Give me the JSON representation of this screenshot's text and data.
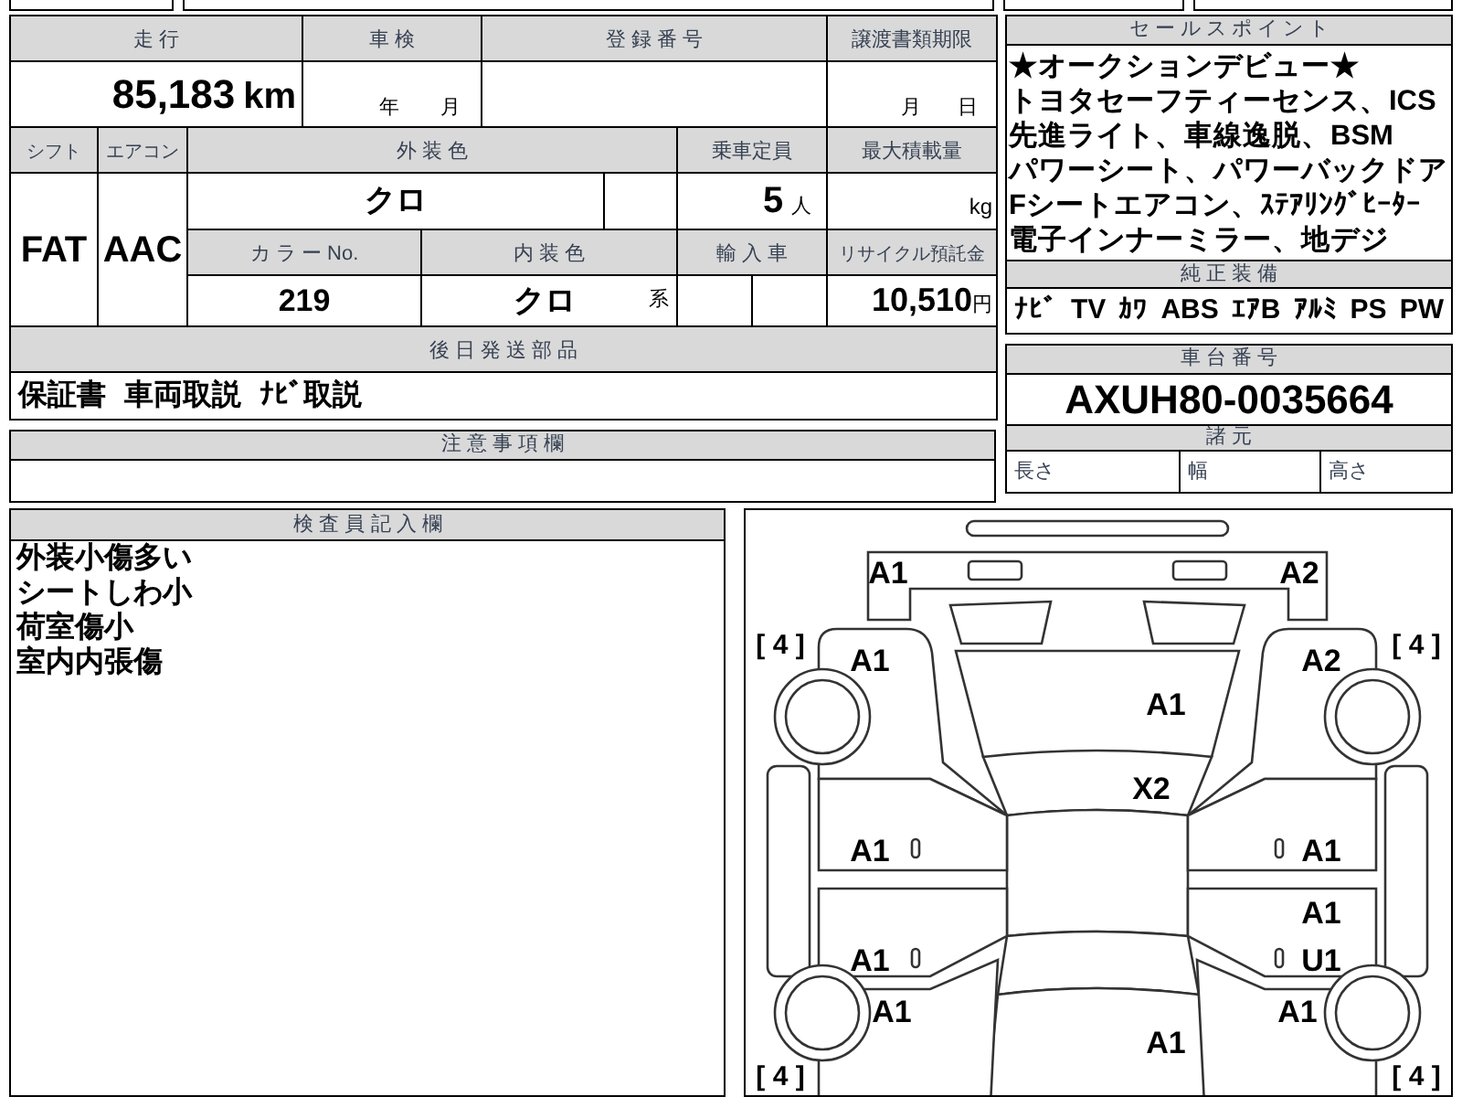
{
  "vehicle_info": {
    "mileage": {
      "label": "走 行",
      "value": "85,183",
      "unit": "km"
    },
    "inspection": {
      "label": "車 検",
      "year_unit": "年",
      "month_unit": "月"
    },
    "registration_number": {
      "label": "登 録 番 号"
    },
    "transfer_deadline": {
      "label": "譲渡書類期限",
      "month_unit": "月",
      "day_unit": "日"
    },
    "shift": {
      "label": "シフト",
      "value": "FAT"
    },
    "air_conditioner": {
      "label": "エアコン",
      "value": "AAC"
    },
    "exterior_color": {
      "label": "外 装 色",
      "value": "クロ"
    },
    "capacity": {
      "label": "乗車定員",
      "value": "5",
      "unit": "人"
    },
    "max_load": {
      "label": "最大積載量",
      "unit": "kg"
    },
    "color_number": {
      "label": "カ ラ ー No.",
      "value": "219"
    },
    "interior_color": {
      "label": "内 装 色",
      "value": "クロ",
      "unit": "系"
    },
    "imported": {
      "label": "輸 入 車"
    },
    "recycling_fee": {
      "label": "リサイクル預託金",
      "value": "10,510",
      "unit": "円"
    },
    "later_parts": {
      "label": "後 日 発 送 部 品",
      "items": [
        "保証書",
        "車両取説",
        "ﾅﾋﾞ取説"
      ]
    }
  },
  "notes": {
    "label": "注 意 事 項 欄"
  },
  "sales_points": {
    "label": "セ ー ル ス ポ イ ン ト",
    "lines": [
      "★オークションデビュー★",
      "トヨタセーフティーセンス、ICS",
      "先進ライト、車線逸脱、BSM",
      "パワーシート、パワーバックドア",
      "Fシートエアコン、ｽﾃｱﾘﾝｸﾞﾋｰﾀｰ",
      "電子インナーミラー、地デジ"
    ]
  },
  "equipment": {
    "label": "純 正 装 備",
    "items": [
      "ﾅﾋﾞ",
      "TV",
      "ｶﾜ",
      "ABS",
      "ｴｱB",
      "ｱﾙﾐ",
      "PS",
      "PW"
    ]
  },
  "chassis": {
    "label": "車 台 番 号",
    "value": "AXUH80-0035664"
  },
  "specs": {
    "label": "諸 元",
    "items": [
      "長さ",
      "幅",
      "高さ"
    ]
  },
  "inspector_notes": {
    "label": "検 査 員 記 入 欄",
    "lines": [
      "外装小傷多い",
      "シートしわ小",
      "荷室傷小",
      "室内内張傷"
    ]
  },
  "damage_diagram": {
    "marks": [
      {
        "kind": "damage",
        "text": "A1"
      },
      {
        "kind": "damage",
        "text": "A2"
      },
      {
        "kind": "tire",
        "text": "[ 4 ]"
      },
      {
        "kind": "damage",
        "text": "A1"
      },
      {
        "kind": "damage",
        "text": "A1"
      },
      {
        "kind": "damage",
        "text": "A2"
      },
      {
        "kind": "tire",
        "text": "[ 4 ]"
      },
      {
        "kind": "damage",
        "text": "X2"
      },
      {
        "kind": "damage",
        "text": "A1"
      },
      {
        "kind": "damage",
        "text": "A1"
      },
      {
        "kind": "damage",
        "text": "A1"
      },
      {
        "kind": "damage",
        "text": "A1"
      },
      {
        "kind": "damage",
        "text": "U1"
      },
      {
        "kind": "damage",
        "text": "A1"
      },
      {
        "kind": "damage",
        "text": "A1"
      },
      {
        "kind": "damage",
        "text": "A1"
      },
      {
        "kind": "tire",
        "text": "[ 4 ]"
      },
      {
        "kind": "tire",
        "text": "[ 4 ]"
      }
    ]
  }
}
